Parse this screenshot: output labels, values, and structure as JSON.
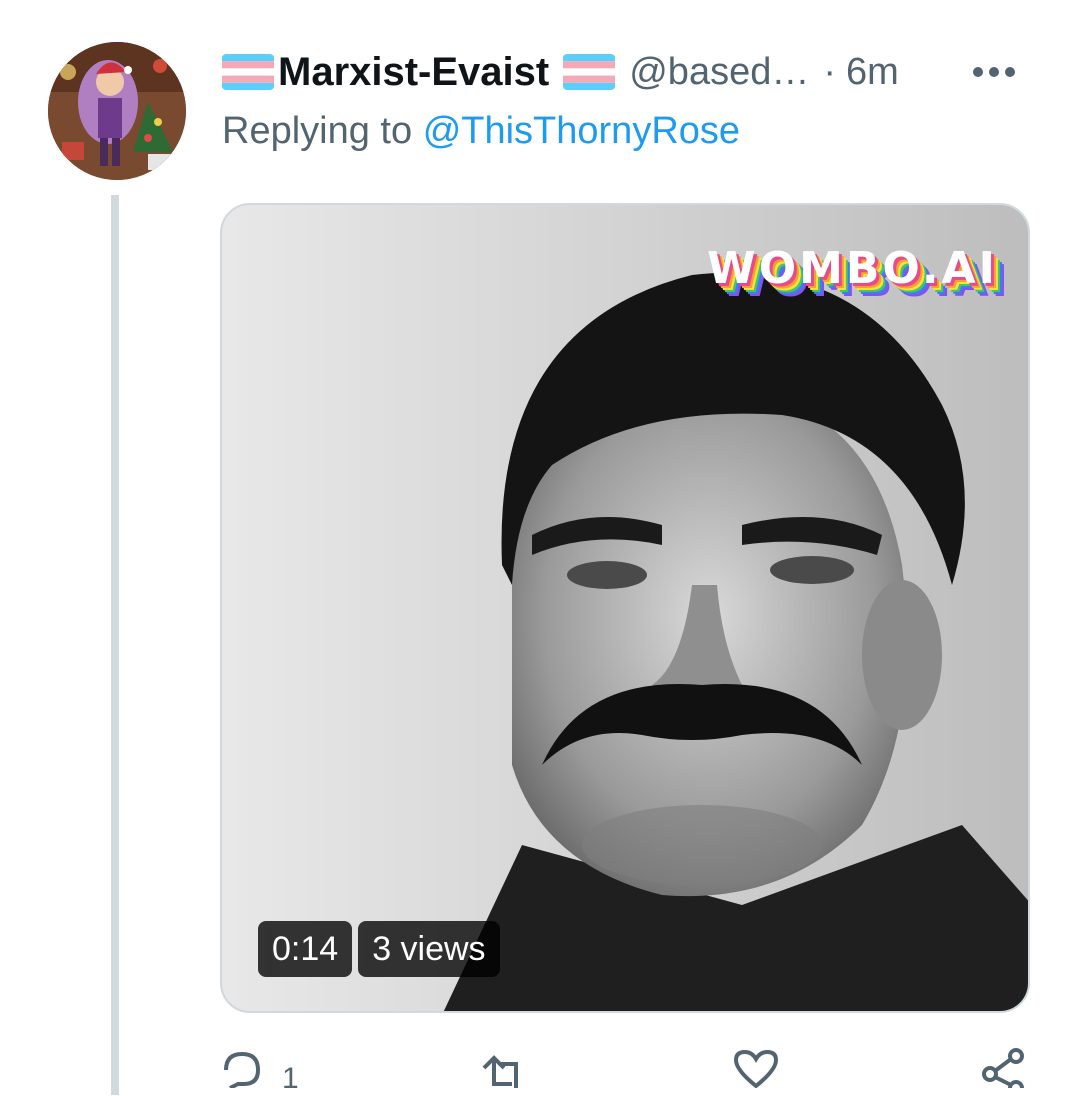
{
  "tweet": {
    "display_name": "Marxist-Evaist",
    "handle": "@based…",
    "separator": "·",
    "time": "6m",
    "reply_prefix": "Replying to",
    "reply_to": "@ThisThornyRose"
  },
  "media": {
    "watermark": "WOMBO.AI",
    "duration": "0:14",
    "views": "3 views"
  },
  "actions": {
    "reply_count": "1"
  },
  "colors": {
    "link": "#1d9bf0",
    "secondary_text": "#536471",
    "trans_blue": "#5bcefa",
    "trans_pink": "#f5a9b8"
  },
  "icons": [
    "trans-flag-icon",
    "more-icon",
    "reply-icon",
    "retweet-icon",
    "like-icon",
    "share-icon"
  ]
}
